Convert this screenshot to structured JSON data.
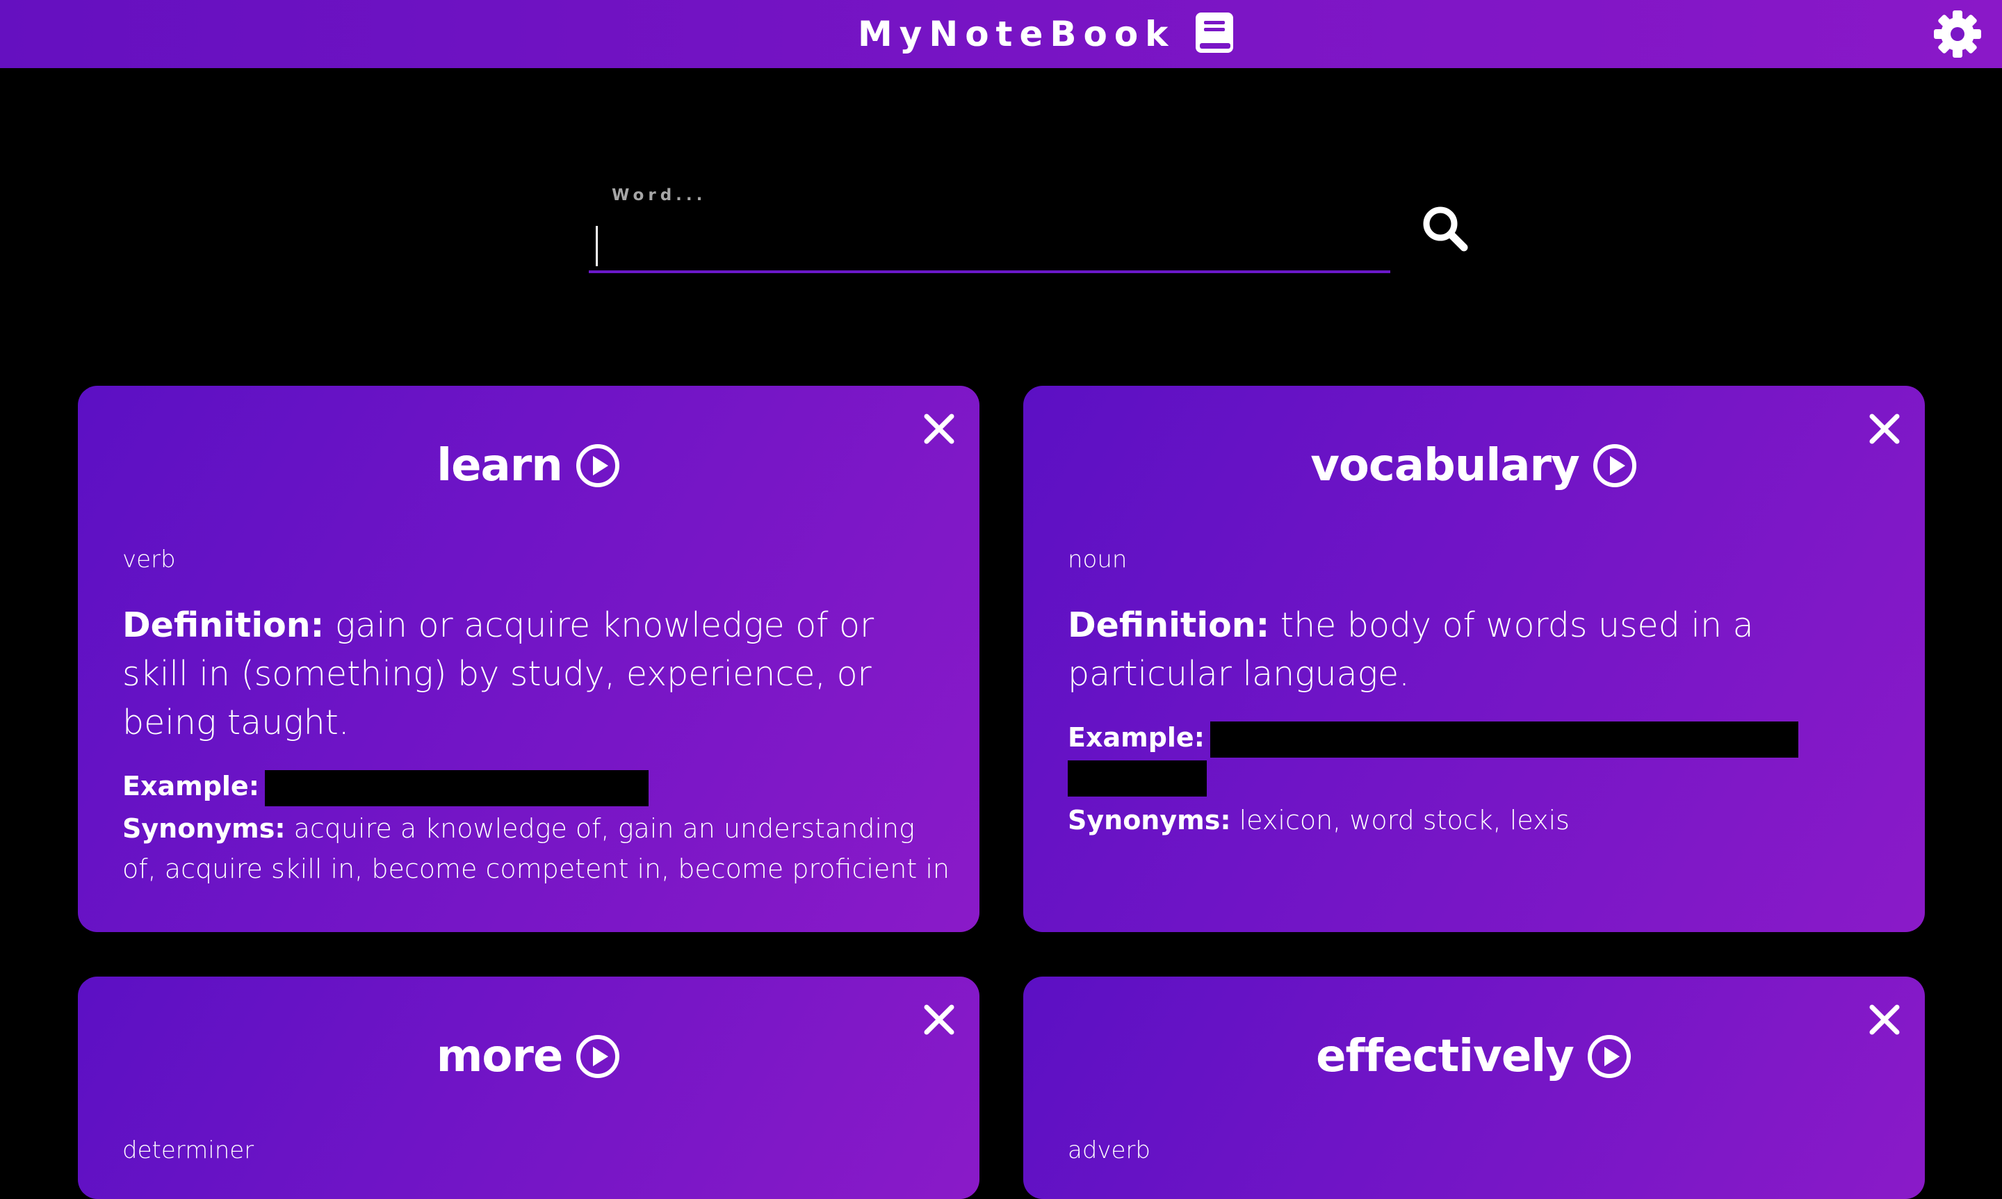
{
  "header": {
    "title": "MyNoteBook",
    "icon": "book-icon",
    "settings_icon": "gear-icon",
    "gradient_start": "#6510c0",
    "gradient_end": "#8a18c8"
  },
  "search": {
    "label": "Word...",
    "value": "",
    "button_icon": "search-icon",
    "underline_color": "#6a18c8"
  },
  "labels": {
    "definition": "Definition:",
    "example": "Example:",
    "synonyms": "Synonyms:"
  },
  "cards": [
    {
      "word": "learn",
      "part_of_speech": "verb",
      "definition": "gain or acquire knowledge of or skill in (something) by study, experience, or being taught.",
      "example_redacted": true,
      "synonyms": "acquire a knowledge of, gain an understanding of, acquire skill in, become competent in, become proficient in"
    },
    {
      "word": "vocabulary",
      "part_of_speech": "noun",
      "definition": "the body of words used in a particular language.",
      "example_redacted": true,
      "synonyms": "lexicon, word stock, lexis"
    },
    {
      "word": "more",
      "part_of_speech": "determiner"
    },
    {
      "word": "effectively",
      "part_of_speech": "adverb"
    }
  ],
  "card_colors": {
    "gradient_start": "#5c10c4",
    "gradient_end": "#8a1ac8"
  }
}
